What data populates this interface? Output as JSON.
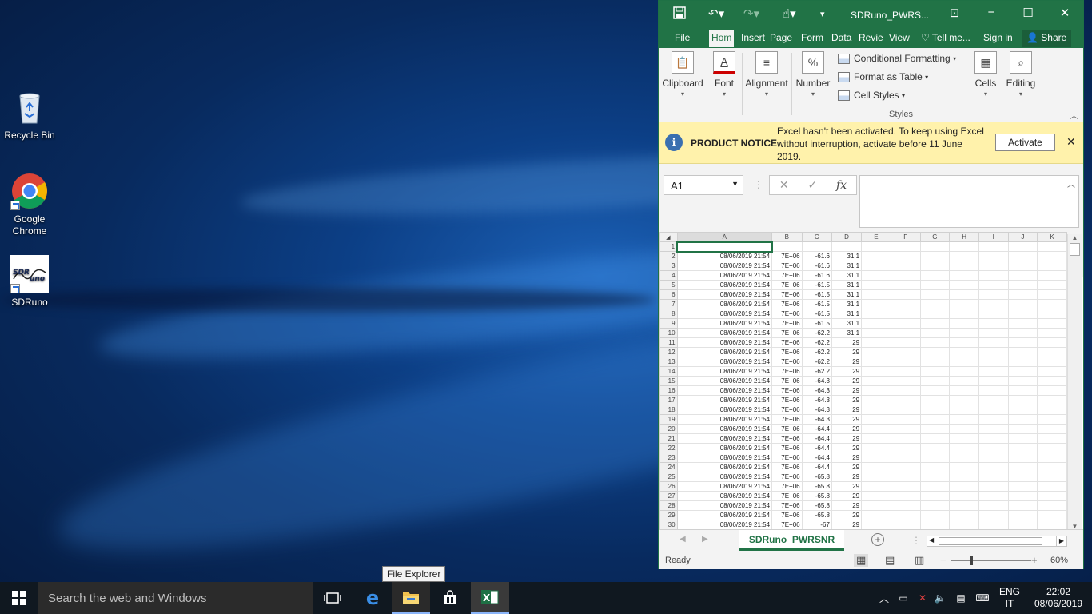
{
  "desktop": {
    "icons": [
      {
        "label": "Recycle Bin"
      },
      {
        "label": "Google Chrome"
      },
      {
        "label": "SDRuno"
      }
    ]
  },
  "excel": {
    "window_title": "SDRuno_PWRS...",
    "ribbon_tabs": [
      "File",
      "Hom",
      "Insert",
      "Page",
      "Form",
      "Data",
      "Revie",
      "View"
    ],
    "tell_me": "Tell me...",
    "sign_in": "Sign in",
    "share": "Share",
    "groups": {
      "clipboard": "Clipboard",
      "font": "Font",
      "alignment": "Alignment",
      "number": "Number",
      "cells": "Cells",
      "editing": "Editing",
      "styles": "Styles"
    },
    "styles_items": [
      "Conditional Formatting",
      "Format as Table",
      "Cell Styles"
    ],
    "notice": {
      "title": "PRODUCT NOTICE",
      "message": "Excel hasn't been activated. To keep using Excel without interruption, activate before 11 June 2019.",
      "button": "Activate"
    },
    "name_box": "A1",
    "fx_label": "fx",
    "columns": [
      "A",
      "B",
      "C",
      "D",
      "E",
      "F",
      "G",
      "H",
      "I",
      "J",
      "K"
    ],
    "rows": [
      {
        "n": "1",
        "a": "",
        "b": "",
        "c": "",
        "d": ""
      },
      {
        "n": "2",
        "a": "08/06/2019 21:54",
        "b": "7E+06",
        "c": "-61.6",
        "d": "31.1"
      },
      {
        "n": "3",
        "a": "08/06/2019 21:54",
        "b": "7E+06",
        "c": "-61.6",
        "d": "31.1"
      },
      {
        "n": "4",
        "a": "08/06/2019 21:54",
        "b": "7E+06",
        "c": "-61.6",
        "d": "31.1"
      },
      {
        "n": "5",
        "a": "08/06/2019 21:54",
        "b": "7E+06",
        "c": "-61.5",
        "d": "31.1"
      },
      {
        "n": "6",
        "a": "08/06/2019 21:54",
        "b": "7E+06",
        "c": "-61.5",
        "d": "31.1"
      },
      {
        "n": "7",
        "a": "08/06/2019 21:54",
        "b": "7E+06",
        "c": "-61.5",
        "d": "31.1"
      },
      {
        "n": "8",
        "a": "08/06/2019 21:54",
        "b": "7E+06",
        "c": "-61.5",
        "d": "31.1"
      },
      {
        "n": "9",
        "a": "08/06/2019 21:54",
        "b": "7E+06",
        "c": "-61.5",
        "d": "31.1"
      },
      {
        "n": "10",
        "a": "08/06/2019 21:54",
        "b": "7E+06",
        "c": "-62.2",
        "d": "31.1"
      },
      {
        "n": "11",
        "a": "08/06/2019 21:54",
        "b": "7E+06",
        "c": "-62.2",
        "d": "29"
      },
      {
        "n": "12",
        "a": "08/06/2019 21:54",
        "b": "7E+06",
        "c": "-62.2",
        "d": "29"
      },
      {
        "n": "13",
        "a": "08/06/2019 21:54",
        "b": "7E+06",
        "c": "-62.2",
        "d": "29"
      },
      {
        "n": "14",
        "a": "08/06/2019 21:54",
        "b": "7E+06",
        "c": "-62.2",
        "d": "29"
      },
      {
        "n": "15",
        "a": "08/06/2019 21:54",
        "b": "7E+06",
        "c": "-64.3",
        "d": "29"
      },
      {
        "n": "16",
        "a": "08/06/2019 21:54",
        "b": "7E+06",
        "c": "-64.3",
        "d": "29"
      },
      {
        "n": "17",
        "a": "08/06/2019 21:54",
        "b": "7E+06",
        "c": "-64.3",
        "d": "29"
      },
      {
        "n": "18",
        "a": "08/06/2019 21:54",
        "b": "7E+06",
        "c": "-64.3",
        "d": "29"
      },
      {
        "n": "19",
        "a": "08/06/2019 21:54",
        "b": "7E+06",
        "c": "-64.3",
        "d": "29"
      },
      {
        "n": "20",
        "a": "08/06/2019 21:54",
        "b": "7E+06",
        "c": "-64.4",
        "d": "29"
      },
      {
        "n": "21",
        "a": "08/06/2019 21:54",
        "b": "7E+06",
        "c": "-64.4",
        "d": "29"
      },
      {
        "n": "22",
        "a": "08/06/2019 21:54",
        "b": "7E+06",
        "c": "-64.4",
        "d": "29"
      },
      {
        "n": "23",
        "a": "08/06/2019 21:54",
        "b": "7E+06",
        "c": "-64.4",
        "d": "29"
      },
      {
        "n": "24",
        "a": "08/06/2019 21:54",
        "b": "7E+06",
        "c": "-64.4",
        "d": "29"
      },
      {
        "n": "25",
        "a": "08/06/2019 21:54",
        "b": "7E+06",
        "c": "-65.8",
        "d": "29"
      },
      {
        "n": "26",
        "a": "08/06/2019 21:54",
        "b": "7E+06",
        "c": "-65.8",
        "d": "29"
      },
      {
        "n": "27",
        "a": "08/06/2019 21:54",
        "b": "7E+06",
        "c": "-65.8",
        "d": "29"
      },
      {
        "n": "28",
        "a": "08/06/2019 21:54",
        "b": "7E+06",
        "c": "-65.8",
        "d": "29"
      },
      {
        "n": "29",
        "a": "08/06/2019 21:54",
        "b": "7E+06",
        "c": "-65.8",
        "d": "29"
      },
      {
        "n": "30",
        "a": "08/06/2019 21:54",
        "b": "7E+06",
        "c": "-67",
        "d": "29"
      }
    ],
    "sheet_tab": "SDRuno_PWRSNR",
    "status": "Ready",
    "zoom": "60%",
    "accent": "#217346"
  },
  "taskbar": {
    "search_placeholder": "Search the web and Windows",
    "tooltip": "File Explorer",
    "lang_top": "ENG",
    "lang_bottom": "IT",
    "time": "22:02",
    "date": "08/06/2019"
  }
}
